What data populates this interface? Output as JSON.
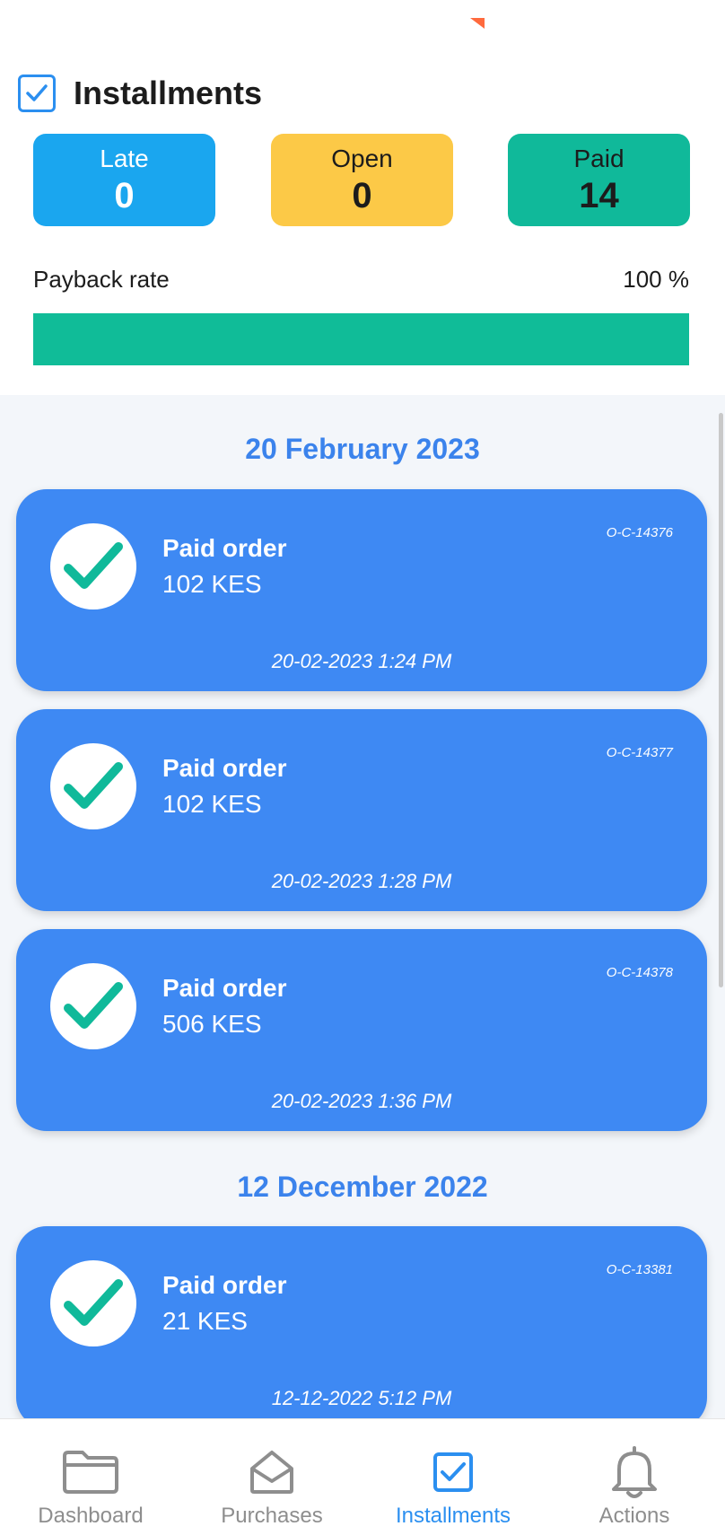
{
  "header": {
    "title": "Installments"
  },
  "stats": {
    "late": {
      "label": "Late",
      "value": "0"
    },
    "open": {
      "label": "Open",
      "value": "0"
    },
    "paid": {
      "label": "Paid",
      "value": "14"
    }
  },
  "payback": {
    "label": "Payback rate",
    "value_text": "100 %",
    "fraction": 1.0
  },
  "groups": [
    {
      "date": "20 February 2023",
      "orders": [
        {
          "title": "Paid order",
          "amount": "102 KES",
          "code": "O-C-14376",
          "time": "20-02-2023 1:24 PM"
        },
        {
          "title": "Paid order",
          "amount": "102 KES",
          "code": "O-C-14377",
          "time": "20-02-2023 1:28 PM"
        },
        {
          "title": "Paid order",
          "amount": "506 KES",
          "code": "O-C-14378",
          "time": "20-02-2023 1:36 PM"
        }
      ]
    },
    {
      "date": "12 December 2022",
      "orders": [
        {
          "title": "Paid order",
          "amount": "21 KES",
          "code": "O-C-13381",
          "time": "12-12-2022 5:12 PM"
        }
      ]
    }
  ],
  "nav": {
    "items": [
      {
        "label": "Dashboard",
        "icon": "folder-icon"
      },
      {
        "label": "Purchases",
        "icon": "envelope-open-icon"
      },
      {
        "label": "Installments",
        "icon": "checkbox-icon"
      },
      {
        "label": "Actions",
        "icon": "bell-icon"
      }
    ],
    "active": "Installments"
  },
  "colors": {
    "late": "#1aa6ef",
    "open": "#fcc947",
    "paid": "#10b99a",
    "card": "#3e89f3",
    "accent": "#2b8ff0",
    "check": "#10b99a"
  }
}
